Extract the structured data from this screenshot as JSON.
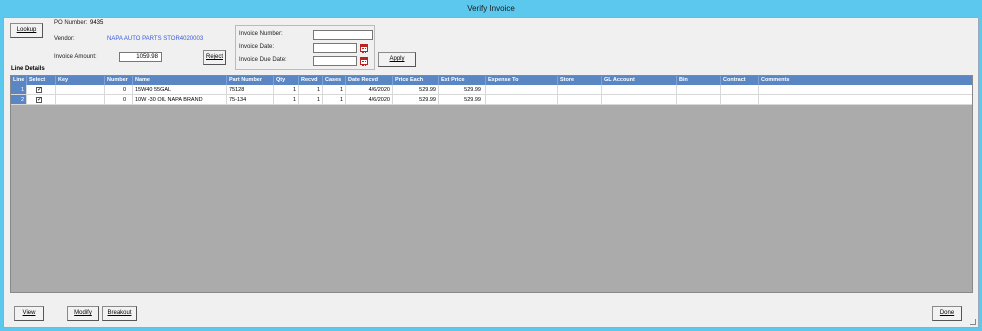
{
  "window": {
    "title": "Verify Invoice"
  },
  "header": {
    "lookup_label": "Lookup",
    "po_number_label": "PO Number:",
    "po_number": "9435",
    "vendor_label": "Vendor:",
    "vendor": "NAPA AUTO PARTS STOR4020003",
    "invoice_amount_label": "Invoice Amount:",
    "invoice_amount": "1059.98",
    "reject_label": "Reject"
  },
  "invoice_box": {
    "invoice_number_label": "Invoice Number:",
    "invoice_number": "",
    "invoice_date_label": "Invoice Date:",
    "invoice_date": "",
    "invoice_due_date_label": "Invoice Due Date:",
    "invoice_due_date": "",
    "apply_label": "Apply"
  },
  "line_details": {
    "title": "Line Details",
    "columns": [
      "Line",
      "Select",
      "Key",
      "Number",
      "Name",
      "Part Number",
      "Qty",
      "Recvd",
      "Cases",
      "Date Recvd",
      "Price Each",
      "Ext Price",
      "Expense To",
      "Store",
      "GL Account",
      "Bin",
      "Contract",
      "Comments"
    ],
    "rows": [
      {
        "line": "1",
        "select": "✓",
        "key": "",
        "number": "0",
        "name": "15W40 55GAL",
        "part": "75128",
        "qty": "1",
        "recvd": "1",
        "cases": "1",
        "date": "4/6/2020",
        "price": "529.99",
        "ext": "529.99"
      },
      {
        "line": "2",
        "select": "✓",
        "key": "",
        "number": "0",
        "name": "10W -30 OIL NAPA BRAND",
        "part": "75-134",
        "qty": "1",
        "recvd": "1",
        "cases": "1",
        "date": "4/6/2020",
        "price": "529.99",
        "ext": "529.99"
      }
    ]
  },
  "footer": {
    "view_label": "View",
    "modify_label": "Modify",
    "breakout_label": "Breakout",
    "done_label": "Done"
  }
}
